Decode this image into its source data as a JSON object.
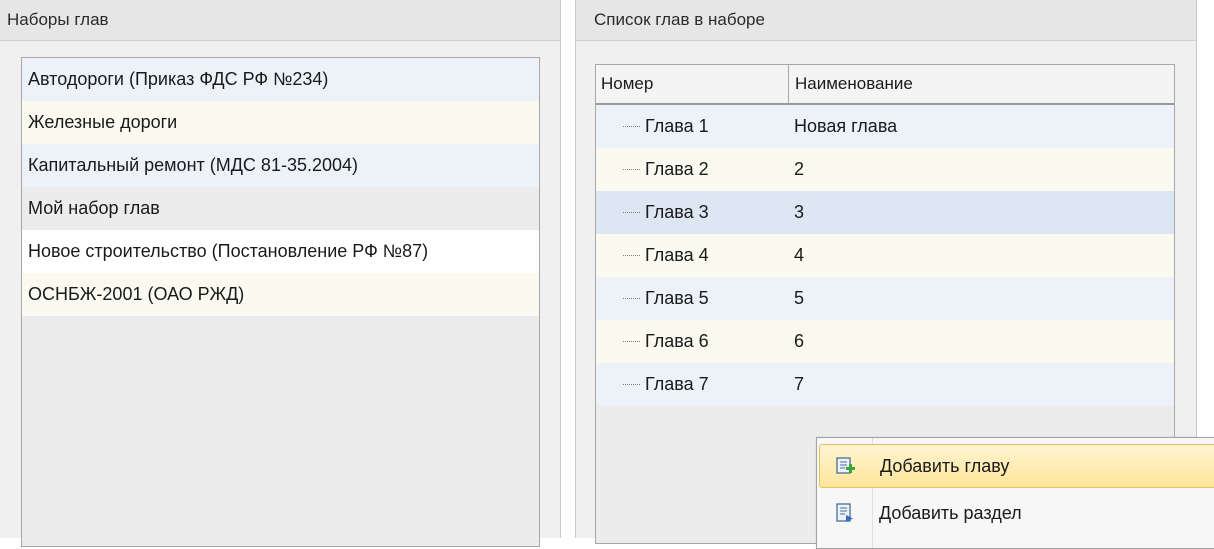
{
  "sets_panel": {
    "title": "Наборы глав",
    "items": [
      {
        "label": "Автодороги (Приказ ФДС РФ №234)"
      },
      {
        "label": "Железные дороги"
      },
      {
        "label": "Капитальный ремонт (МДС 81-35.2004)"
      },
      {
        "label": "Мой набор глав"
      },
      {
        "label": "Новое строительство (Постановление РФ №87)"
      },
      {
        "label": "ОСНБЖ-2001 (ОАО РЖД)"
      }
    ]
  },
  "chapters_panel": {
    "title": "Список глав в наборе",
    "columns": {
      "number": "Номер",
      "name": "Наименование"
    },
    "rows": [
      {
        "number": "Глава 1",
        "name": "Новая глава"
      },
      {
        "number": "Глава 2",
        "name": "2"
      },
      {
        "number": "Глава 3",
        "name": "3"
      },
      {
        "number": "Глава 4",
        "name": "4"
      },
      {
        "number": "Глава 5",
        "name": "5"
      },
      {
        "number": "Глава 6",
        "name": "6"
      },
      {
        "number": "Глава 7",
        "name": "7"
      }
    ],
    "selected_row": "Глава 3"
  },
  "context_menu": {
    "items": [
      {
        "label": "Добавить главу",
        "icon": "add-chapter-icon",
        "highlighted": true
      },
      {
        "label": "Добавить раздел",
        "icon": "add-section-icon",
        "highlighted": false
      }
    ]
  },
  "colors": {
    "menu_highlight": "#ffe59a",
    "row_alt_yellow": "#fbfaf0",
    "row_alt_blue": "#edf2f9",
    "selected_row": "#dde7f3",
    "icon_green": "#3aa53a",
    "icon_blue": "#2f6fc1"
  }
}
